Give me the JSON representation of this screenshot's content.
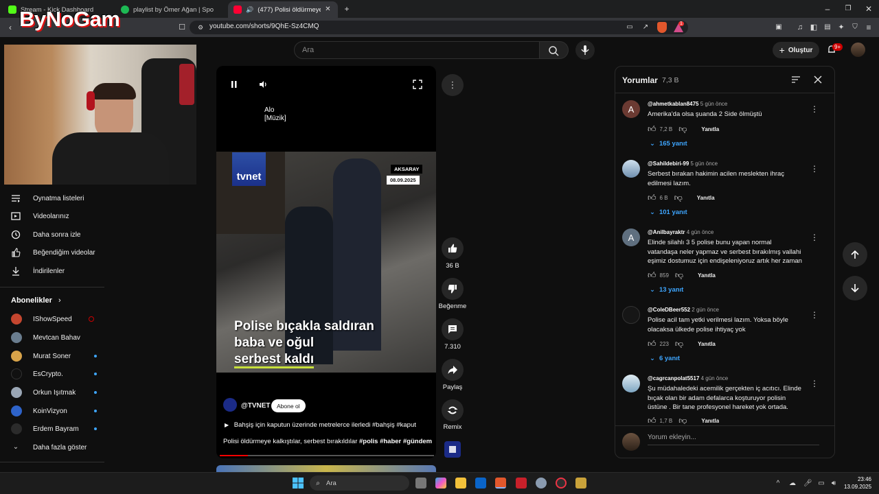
{
  "browser": {
    "tabs": [
      {
        "title": "Stream - Kick Dashboard",
        "color": "#53fc18"
      },
      {
        "title": "playlist by Ömer Ağan | Spo",
        "color": "#1db954"
      },
      {
        "title": "(477) Polisi öldürmeye kalkıştı",
        "color": "#ff0033"
      }
    ],
    "url": "youtube.com/shorts/9QhE-Sz4CMQ",
    "extension_badge": "1"
  },
  "overlay": {
    "logo_text": "ByNoGam"
  },
  "youtube": {
    "search_placeholder": "Ara",
    "create_label": "Oluştur",
    "notification_count": "9+",
    "sidebar": {
      "items": [
        {
          "label": "Oynatma listeleri",
          "icon": "playlist-icon"
        },
        {
          "label": "Videolarınız",
          "icon": "video-icon"
        },
        {
          "label": "Daha sonra izle",
          "icon": "clock-icon"
        },
        {
          "label": "Beğendiğim videolar",
          "icon": "thumb-up-icon"
        },
        {
          "label": "İndirilenler",
          "icon": "download-icon"
        }
      ],
      "subscriptions_title": "Abonelikler",
      "subscriptions": [
        {
          "name": "IShowSpeed",
          "live": true,
          "color": "#c4462f"
        },
        {
          "name": "Mevtcan Bahav",
          "live": false,
          "color": "#6a7d8f"
        },
        {
          "name": "Murat Soner",
          "live": true,
          "color": "#d8a34a"
        },
        {
          "name": "EsCrypto.",
          "live": true,
          "color": "#111111"
        },
        {
          "name": "Orkun Işıtmak",
          "live": true,
          "color": "#9aa6b5"
        },
        {
          "name": "KoinVizyon",
          "live": true,
          "color": "#2e63c9"
        },
        {
          "name": "Erdem Bayram",
          "live": true,
          "color": "#2b2b2b"
        }
      ],
      "show_more": "Daha fazla göster"
    },
    "short": {
      "caption": "Alo\n[Müzik]",
      "channel_logo": "tvnet",
      "location": "AKSARAY",
      "date": "08.09.2025",
      "headline_1": "Polise bıçakla saldıran",
      "headline_2": "baba ve oğul",
      "headline_3": "serbest kaldı",
      "channel": "@TVNET",
      "subscribe": "Abone ol",
      "title": "Bahşiş için kaputun üzerinde metrelerce ilerledi #bahşiş #kaput",
      "description": "Polisi öldürmeye kalkıştılar, serbest bırakıldılar",
      "hashtags": "#polis #haber #gündem",
      "progress": 0.13
    },
    "actions": {
      "likes": "36 B",
      "dislike": "Beğenme",
      "comments": "7.310",
      "share": "Paylaş",
      "remix": "Remix"
    },
    "comments": {
      "title": "Yorumlar",
      "count": "7,3 B",
      "reply_label": "Yanıtla",
      "add_placeholder": "Yorum ekleyin...",
      "list": [
        {
          "user": "@ahmetkablan8475",
          "time": "5 gün önce",
          "avatar": "A",
          "avatar_color": "#6b3a32",
          "text": "Amerika'da olsa şuanda 2 Side ölmüştü",
          "likes": "7,2 B",
          "replies": "165 yanıt"
        },
        {
          "user": "@Sahildebiri-99",
          "time": "5 gün önce",
          "avatar": "",
          "avatar_color": "#8aa5c4",
          "text": "Serbest bırakan hakimin acilen meslekten ihraç edilmesi lazım.",
          "likes": "6 B",
          "replies": "101 yanıt"
        },
        {
          "user": "@Anilbayraktr",
          "time": "4 gün önce",
          "avatar": "A",
          "avatar_color": "#5f6f7f",
          "text": "Elinde silahlı 3 5 polise bunu yapan normal vatandaşa neler yapmaz ve serbest bırakılmış vallahi eşimiz dostumuz için endişeleniyoruz artık her zaman",
          "likes": "859",
          "replies": "13 yanıt"
        },
        {
          "user": "@ColeDBeer552",
          "time": "2 gün önce",
          "avatar": "",
          "avatar_color": "#161616",
          "text": "Polise acil tam yetki verilmesi lazım. Yoksa böyle olacaksa ülkede polise ihtiyaç yok",
          "likes": "223",
          "replies": "6 yanıt"
        },
        {
          "user": "@cagrcanpolat5517",
          "time": "4 gün önce",
          "avatar": "",
          "avatar_color": "#a8c4d8",
          "text": "Şu müdahaledeki acemilik gerçekten iç acıtıcı. Elinde bıçak olan bir adam defalarca koşturuyor polisin üstüne . Bir tane profesyonel hareket yok ortada.",
          "likes": "1,7 B",
          "replies": ""
        }
      ]
    }
  },
  "taskbar": {
    "search": "Ara",
    "time": "23:46",
    "date": "13.09.2025"
  }
}
